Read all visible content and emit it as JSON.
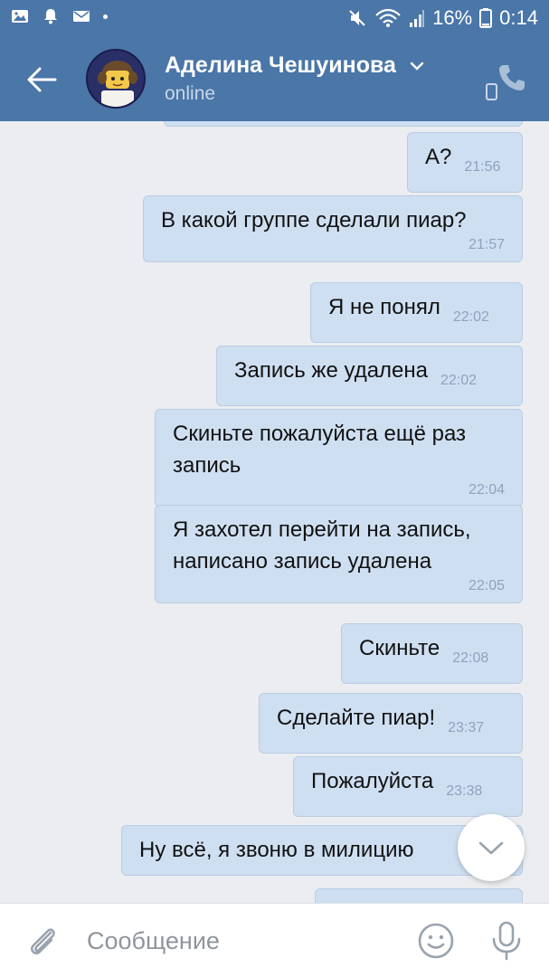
{
  "status_bar": {
    "battery": "16%",
    "time": "0:14",
    "icons": [
      "image-icon",
      "bell-icon",
      "mail-icon",
      "mute-icon",
      "wifi-icon",
      "signal-icon",
      "battery-icon"
    ]
  },
  "header": {
    "contact_name": "Аделина Чешуинова",
    "status": "online",
    "icons": [
      "back-arrow-icon",
      "chevron-down-icon",
      "phone-device-icon",
      "call-icon"
    ]
  },
  "messages": [
    {
      "text": "",
      "time": ""
    },
    {
      "text": "А?",
      "time": "21:56"
    },
    {
      "text": "В какой группе сделали пиар?",
      "time": "21:57"
    },
    {
      "text": "Я не понял",
      "time": "22:02"
    },
    {
      "text": "Запись же удалена",
      "time": "22:02"
    },
    {
      "text": "Скиньте пожалуйста ещё раз запись",
      "time": "22:04"
    },
    {
      "text": "Я захотел перейти на запись, написано запись удалена",
      "time": "22:05"
    },
    {
      "text": "Скиньте",
      "time": "22:08"
    },
    {
      "text": "Сделайте пиар!",
      "time": "23:37"
    },
    {
      "text": "Пожалуйста",
      "time": "23:38"
    },
    {
      "text": "Ну всё, я звоню в милицию",
      "time": ""
    },
    {
      "text": "",
      "time": ""
    }
  ],
  "input": {
    "placeholder": "Сообщение",
    "value": ""
  },
  "colors": {
    "header": "#4a76a8",
    "bubble": "#cfdff2",
    "background": "#ebedf0"
  }
}
